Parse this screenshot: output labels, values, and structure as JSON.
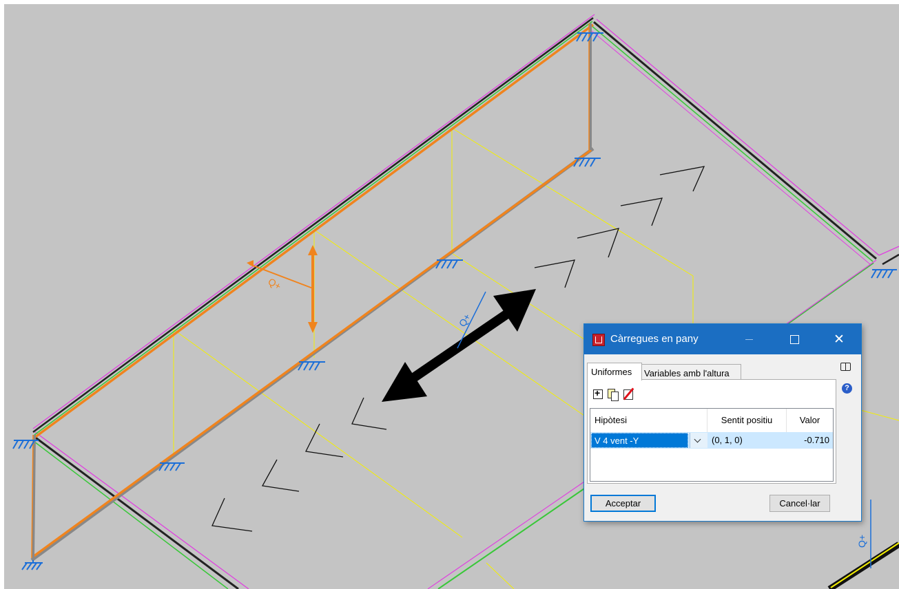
{
  "viewport": {
    "load_label": "Q+"
  },
  "dialog": {
    "title": "Càrregues en pany",
    "close_glyph": "✕",
    "tabs": [
      "Uniformes",
      "Variables amb l'altura"
    ],
    "columns": [
      "Hipòtesi",
      "Sentit positiu",
      "Valor"
    ],
    "rows": [
      {
        "hipotesi": "V 4 vent -Y",
        "sentit": "(0, 1, 0)",
        "valor": "-0.710"
      }
    ],
    "accept_label": "Acceptar",
    "cancel_label": "Cancel·lar",
    "help_label": "?"
  },
  "icons": [
    "app-icon",
    "add-row-icon",
    "copy-row-icon",
    "delete-row-icon",
    "help-book-icon",
    "help-icon",
    "support-icon"
  ],
  "colors": {
    "background": "#c4c4c4",
    "frame_orange": "#f0841e",
    "frame_gray": "#808080",
    "edge_magenta": "#e040e0",
    "edge_green": "#38c838",
    "guide_yellow": "#f5f000",
    "support_blue": "#1a6ed8",
    "title_bar": "#1b6ec2",
    "selection": "#0078d7"
  }
}
